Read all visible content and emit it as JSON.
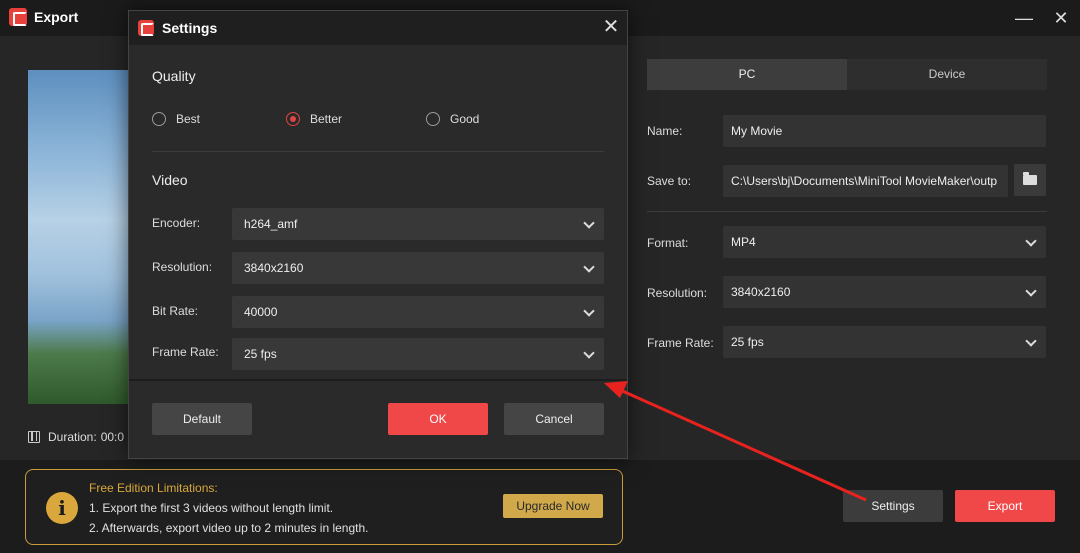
{
  "window": {
    "title": "Export",
    "minimize_glyph": "—",
    "close_glyph": "✕"
  },
  "preview": {
    "duration_label": "Duration:",
    "duration_value": "00:0"
  },
  "tabs": [
    {
      "label": "PC",
      "active": true
    },
    {
      "label": "Device",
      "active": false
    }
  ],
  "form": {
    "name_label": "Name:",
    "name_value": "My Movie",
    "save_label": "Save to:",
    "save_value": "C:\\Users\\bj\\Documents\\MiniTool MovieMaker\\outp",
    "format_label": "Format:",
    "format_value": "MP4",
    "resolution_label": "Resolution:",
    "resolution_value": "3840x2160",
    "framerate_label": "Frame Rate:",
    "framerate_value": "25 fps"
  },
  "limitations": {
    "title": "Free Edition Limitations:",
    "line1": "1. Export the first 3 videos without length limit.",
    "line2": "2. Afterwards, export video up to 2 minutes in length.",
    "upgrade_label": "Upgrade Now",
    "info_glyph": "i"
  },
  "actions": {
    "settings_label": "Settings",
    "export_label": "Export"
  },
  "dialog": {
    "title": "Settings",
    "close_glyph": "✕",
    "quality_title": "Quality",
    "quality_options": [
      {
        "label": "Best",
        "selected": false
      },
      {
        "label": "Better",
        "selected": true
      },
      {
        "label": "Good",
        "selected": false
      }
    ],
    "video_title": "Video",
    "encoder_label": "Encoder:",
    "encoder_value": "h264_amf",
    "resolution_label": "Resolution:",
    "resolution_value": "3840x2160",
    "bitrate_label": "Bit Rate:",
    "bitrate_value": "40000",
    "framerate_label": "Frame Rate:",
    "framerate_value": "25 fps",
    "default_label": "Default",
    "ok_label": "OK",
    "cancel_label": "Cancel"
  },
  "colors": {
    "accent": "#f04848",
    "gold": "#d9a73c",
    "annotation": "#e8231f"
  }
}
